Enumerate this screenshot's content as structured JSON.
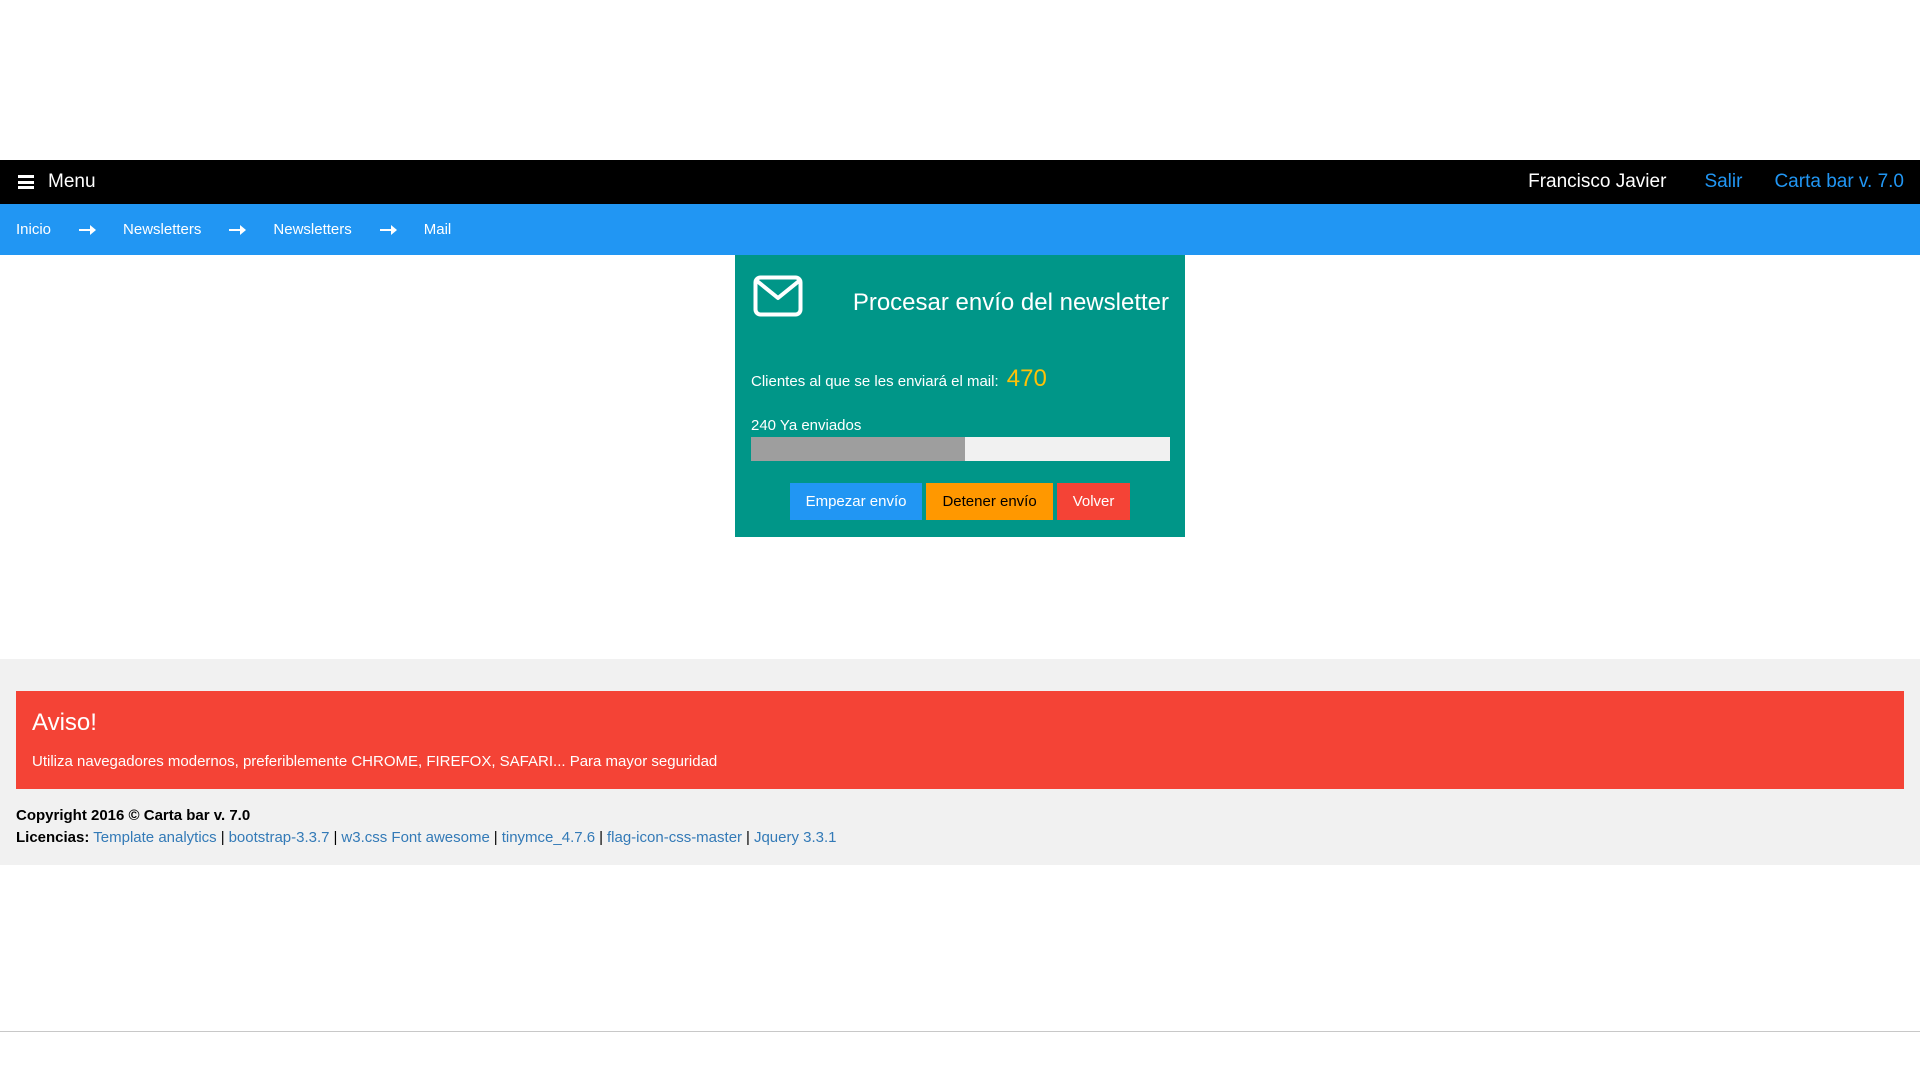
{
  "topbar": {
    "menu_label": "Menu",
    "user_name": "Francisco Javier",
    "logout_label": "Salir",
    "version_label": "Carta bar v. 7.0"
  },
  "breadcrumb": {
    "items": [
      {
        "label": "Inicio"
      },
      {
        "label": "Newsletters"
      },
      {
        "label": "Newsletters"
      },
      {
        "label": "Mail"
      }
    ]
  },
  "panel": {
    "icon": "envelope-icon",
    "title": "Procesar envío del newsletter",
    "clients_label": "Clientes al que se les enviará el mail:",
    "clients_count": "470",
    "sent_label": "240 Ya enviados",
    "progress_fraction": 0.51,
    "buttons": {
      "start": "Empezar envío",
      "stop": "Detener envío",
      "back": "Volver"
    }
  },
  "footer": {
    "alert_title": "Aviso!",
    "alert_text": "Utiliza navegadores modernos, preferiblemente CHROME, FIREFOX, SAFARI... Para mayor seguridad",
    "copyright": "Copyright 2016 © Carta bar v. 7.0",
    "licenses_label": "Licencias:",
    "licenses": [
      "Template analytics",
      "bootstrap-3.3.7",
      "w3.css Font awesome",
      "tinymce_4.7.6",
      "flag-icon-css-master",
      "Jquery 3.3.1"
    ]
  },
  "colors": {
    "topbar": "#000000",
    "breadcrumb": "#2196f3",
    "panel": "#009688",
    "count": "#ffc107",
    "start_button": "#2196f3",
    "stop_button": "#ff9800",
    "back_button": "#f44336",
    "alert": "#f44336",
    "link": "#337ab7"
  }
}
